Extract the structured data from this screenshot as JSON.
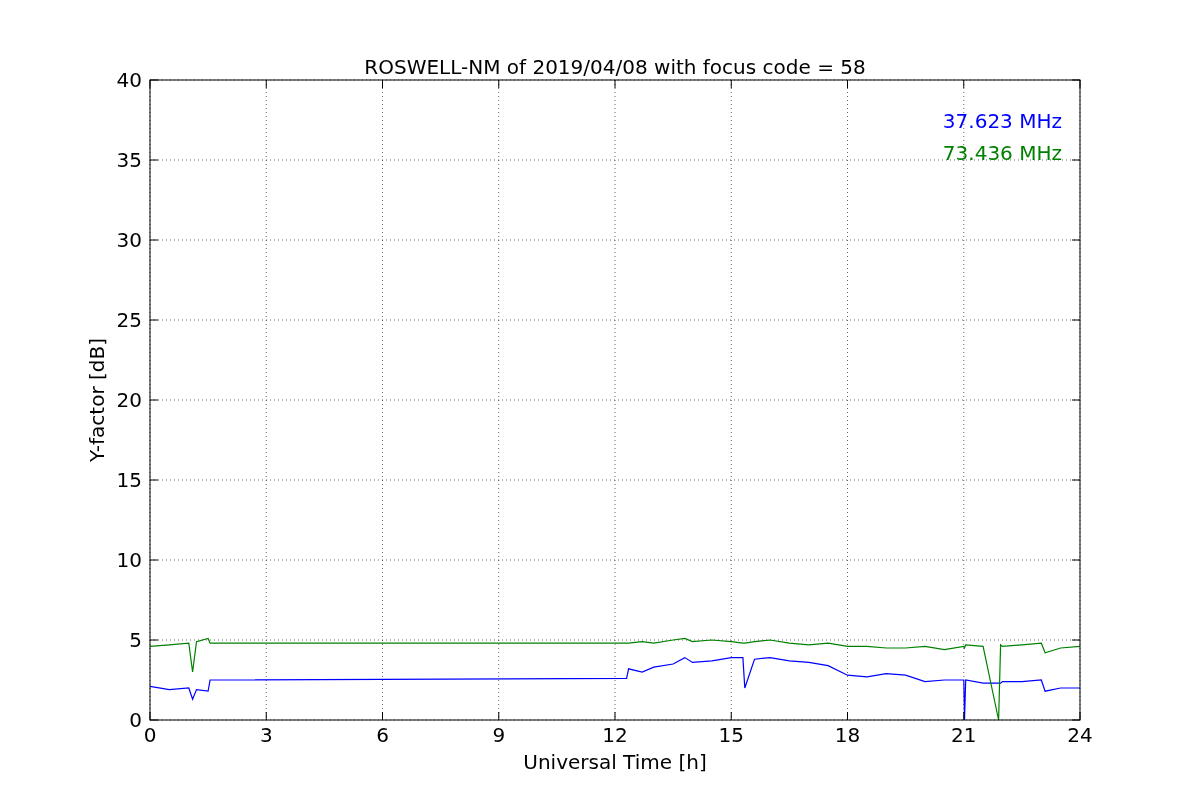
{
  "figure": {
    "chart_data": {
      "type": "line",
      "title": "ROSWELL-NM of 2019/04/08 with focus code = 58",
      "xlabel": "Universal Time [h]",
      "ylabel": "Y-factor [dB]",
      "x": [
        0,
        0.5,
        1,
        1.1,
        1.2,
        1.5,
        1.55,
        12.3,
        12.35,
        12.7,
        13,
        13.5,
        13.8,
        14,
        14.5,
        15,
        15.3,
        15.35,
        15.6,
        16,
        16.5,
        17,
        17.5,
        18,
        18.5,
        19,
        19.5,
        20,
        20.5,
        21,
        21.02,
        21.05,
        21.5,
        21.9,
        21.95,
        22,
        22.5,
        23,
        23.1,
        23.5,
        24
      ],
      "series": [
        {
          "name": "37.623 MHz",
          "color": "#0000ff",
          "values": [
            2.1,
            1.9,
            2.0,
            1.3,
            1.9,
            1.8,
            2.5,
            2.6,
            3.2,
            3.0,
            3.3,
            3.5,
            3.9,
            3.6,
            3.7,
            3.9,
            3.9,
            2.0,
            3.8,
            3.9,
            3.7,
            3.6,
            3.4,
            2.8,
            2.7,
            2.9,
            2.8,
            2.4,
            2.5,
            2.5,
            0,
            2.5,
            2.3,
            2.3,
            2.3,
            2.4,
            2.4,
            2.5,
            1.8,
            2.0,
            2.0
          ]
        },
        {
          "name": "73.436 MHz",
          "color": "#008000",
          "values": [
            4.6,
            4.7,
            4.8,
            3.0,
            4.9,
            5.1,
            4.8,
            4.8,
            4.8,
            4.9,
            4.8,
            5.0,
            5.1,
            4.9,
            5.0,
            4.9,
            4.8,
            4.8,
            4.9,
            5.0,
            4.8,
            4.7,
            4.8,
            4.6,
            4.6,
            4.5,
            4.5,
            4.6,
            4.4,
            4.6,
            4.5,
            4.7,
            4.6,
            0,
            4.7,
            4.6,
            4.7,
            4.8,
            4.2,
            4.5,
            4.6
          ]
        }
      ],
      "xlim": [
        0,
        24
      ],
      "ylim": [
        0,
        40
      ],
      "xticks": [
        0,
        3,
        6,
        9,
        12,
        15,
        18,
        21,
        24
      ],
      "yticks": [
        0,
        5,
        10,
        15,
        20,
        25,
        30,
        35,
        40
      ],
      "grid": true
    }
  }
}
